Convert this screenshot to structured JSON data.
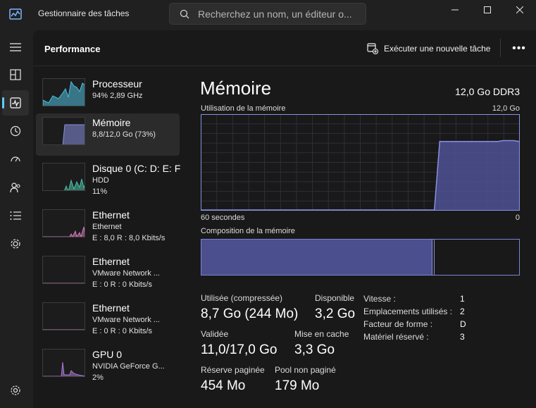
{
  "app": {
    "title": "Gestionnaire des tâches"
  },
  "search": {
    "placeholder": "Recherchez un nom, un éditeur o..."
  },
  "header": {
    "title": "Performance",
    "run_task_label": "Exécuter une nouvelle tâche",
    "more_label": "•••"
  },
  "nav": {
    "items": [
      "hamburger-icon",
      "processes-icon",
      "performance-icon",
      "app-history-icon",
      "startup-apps-icon",
      "users-icon",
      "details-icon",
      "services-icon",
      "settings-icon"
    ],
    "active": "performance-icon"
  },
  "devices": [
    {
      "name": "Processeur",
      "line1": "94%  2,89 GHz",
      "line2": "",
      "color": "#4ec0e0"
    },
    {
      "name": "Mémoire",
      "line1": "8,8/12,0 Go (73%)",
      "line2": "",
      "color": "#8890e0"
    },
    {
      "name": "Disque 0 (C: D: E: F",
      "line1": "HDD",
      "line2": "11%",
      "color": "#4ec0a8"
    },
    {
      "name": "Ethernet",
      "line1": "Ethernet",
      "line2": "E : 8,0  R : 8,0 Kbits/s",
      "color": "#d27ab8"
    },
    {
      "name": "Ethernet",
      "line1": "VMware Network ...",
      "line2": "E : 0  R : 0 Kbits/s",
      "color": "#d27ab8"
    },
    {
      "name": "Ethernet",
      "line1": "VMware Network ...",
      "line2": "E : 0  R : 0 Kbits/s",
      "color": "#d27ab8"
    },
    {
      "name": "GPU 0",
      "line1": "NVIDIA GeForce G...",
      "line2": "2%",
      "color": "#a97ad2"
    }
  ],
  "memory": {
    "title": "Mémoire",
    "spec": "12,0 Go DDR3",
    "usage_label": "Utilisation de la mémoire",
    "usage_max": "12,0 Go",
    "time_left": "60 secondes",
    "time_right": "0",
    "composition_label": "Composition de la mémoire",
    "composition": {
      "in_use_fraction": 0.73,
      "modified_fraction": 0.007
    },
    "usage_history": [
      0,
      0,
      0,
      0,
      0,
      0,
      0,
      0,
      0,
      0,
      0,
      0,
      0,
      0,
      0,
      0,
      0,
      0,
      0,
      0,
      0,
      0,
      0,
      0,
      0,
      0,
      0,
      0,
      0,
      0,
      0,
      0,
      0,
      0,
      0,
      0,
      0,
      0,
      0,
      0,
      0,
      0,
      0,
      0,
      0,
      0.72,
      0.72,
      0.72,
      0.72,
      0.72,
      0.72,
      0.72,
      0.72,
      0.72,
      0.72,
      0.72,
      0.72,
      0.73,
      0.73,
      0.73,
      0.72
    ],
    "stats": {
      "used_label": "Utilisée (compressée)",
      "used_value": "8,7 Go (244 Mo)",
      "available_label": "Disponible",
      "available_value": "3,2 Go",
      "committed_label": "Validée",
      "committed_value": "11,0/17,0 Go",
      "cached_label": "Mise en cache",
      "cached_value": "3,3 Go",
      "paged_label": "Réserve paginée",
      "paged_value": "454 Mo",
      "nonpaged_label": "Pool non paginé",
      "nonpaged_value": "179 Mo"
    },
    "details": [
      {
        "label": "Vitesse :",
        "value": "1"
      },
      {
        "label": "Emplacements utilisés :",
        "value": "2"
      },
      {
        "label": "Facteur de forme :",
        "value": "D"
      },
      {
        "label": "Matériel réservé :",
        "value": "3"
      }
    ]
  },
  "colors": {
    "accent": "#60cdff",
    "memory": "#8890e0",
    "memory_fill": "#4b4f8d"
  }
}
